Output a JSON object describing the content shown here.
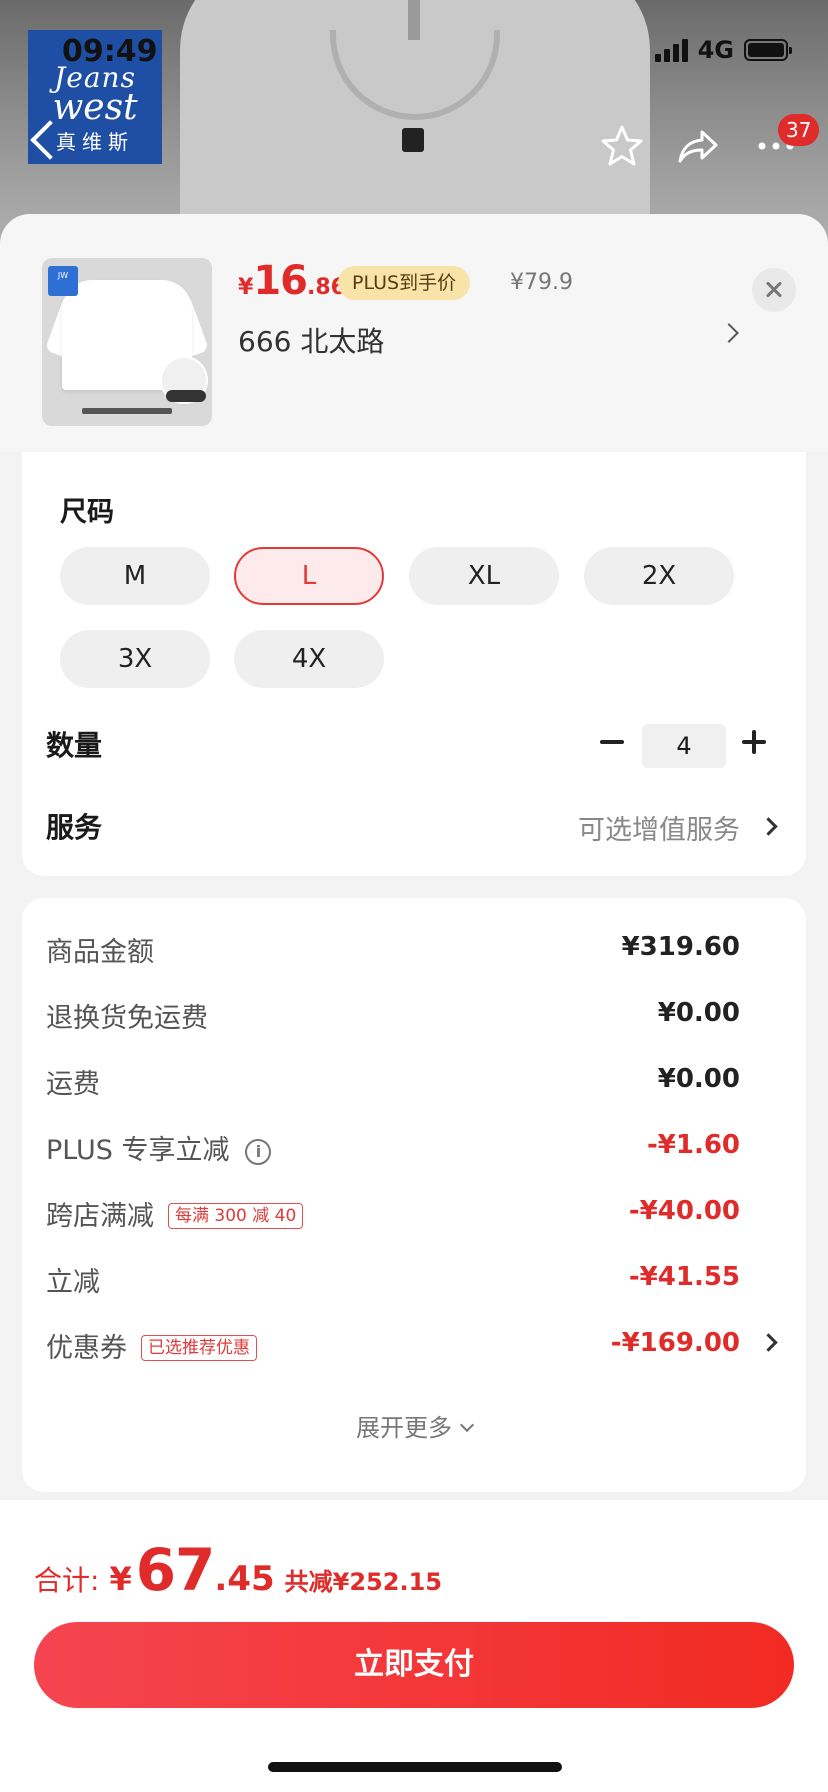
{
  "status_bar": {
    "time": "09:49",
    "network": "4G"
  },
  "brand": {
    "logo_line1": "Jeans",
    "logo_line2": "west",
    "logo_cn": "真维斯"
  },
  "nav": {
    "cart_badge": "37"
  },
  "product": {
    "price_currency": "¥",
    "price_int": "16",
    "price_dec": ".86",
    "plus_tag": "PLUS到手价",
    "original_price": "¥79.9",
    "address": "666  北太路"
  },
  "size": {
    "label": "尺码",
    "options": [
      "M",
      "L",
      "XL",
      "2X",
      "3X",
      "4X"
    ],
    "selected": "L"
  },
  "quantity": {
    "label": "数量",
    "value": "4"
  },
  "service": {
    "label": "服务",
    "value": "可选增值服务"
  },
  "summary": {
    "rows": [
      {
        "label": "商品金额",
        "value": "¥319.60"
      },
      {
        "label": "退换货免运费",
        "value": "¥0.00"
      },
      {
        "label": "运费",
        "value": "¥0.00"
      },
      {
        "label": "PLUS 专享立减",
        "value": "-¥1.60"
      },
      {
        "label": "跨店满减",
        "tag": "每满 300 减 40",
        "value": "-¥40.00"
      },
      {
        "label": "立减",
        "value": "-¥41.55"
      },
      {
        "label": "优惠券",
        "tag": "已选推荐优惠",
        "value": "-¥169.00"
      }
    ],
    "expand": "展开更多"
  },
  "footer": {
    "total_label": "合计:",
    "total_currency": "¥",
    "total_int": "67",
    "total_dec": ".45",
    "saved": "共减¥252.15",
    "pay_button": "立即支付"
  },
  "colors": {
    "accent": "#e02b2b",
    "plus_tag_bg": "#f8e4a8",
    "brand_blue": "#1f4fa5"
  }
}
